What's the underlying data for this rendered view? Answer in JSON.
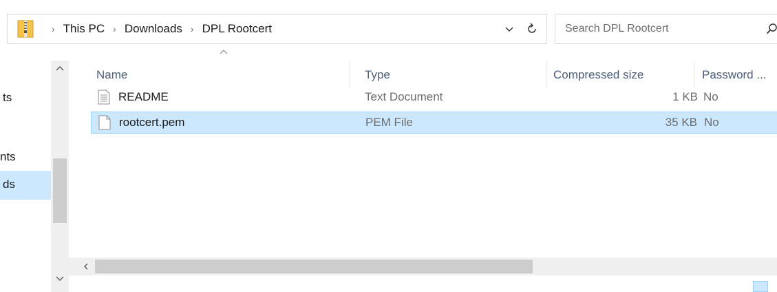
{
  "address": {
    "breadcrumbs": [
      "This PC",
      "Downloads",
      "DPL Rootcert"
    ],
    "separator": "›"
  },
  "search": {
    "placeholder": "Search DPL Rootcert"
  },
  "nav": {
    "items": [
      {
        "label": "ts",
        "selected": false
      },
      {
        "label": "nts",
        "selected": false
      },
      {
        "label": "ds",
        "selected": true
      }
    ]
  },
  "columns": {
    "name": "Name",
    "type": "Type",
    "compressed_size": "Compressed size",
    "password": "Password ..."
  },
  "files": [
    {
      "name": "README",
      "type": "Text Document",
      "size": "1 KB",
      "password": "No",
      "selected": false,
      "icon": "text-document-icon"
    },
    {
      "name": "rootcert.pem",
      "type": "PEM File",
      "size": "35 KB",
      "password": "No",
      "selected": true,
      "icon": "blank-file-icon"
    }
  ],
  "colors": {
    "selection_bg": "#cce8ff",
    "selection_border": "#99d1ff",
    "header_text": "#4c607a"
  }
}
